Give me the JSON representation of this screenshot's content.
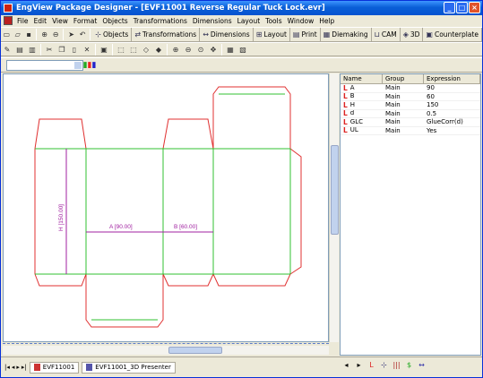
{
  "window": {
    "title": "EngView Package Designer - [EVF11001 Reverse Regular Tuck Lock.evr]"
  },
  "menu": [
    "File",
    "Edit",
    "View",
    "Format",
    "Objects",
    "Transformations",
    "Dimensions",
    "Layout",
    "Tools",
    "Window",
    "Help"
  ],
  "toolbar": {
    "tabs": [
      {
        "name": "objects",
        "label": "Objects",
        "glyph": "⊹"
      },
      {
        "name": "transformations",
        "label": "Transformations",
        "glyph": "⇄"
      },
      {
        "name": "dimensions",
        "label": "Dimensions",
        "glyph": "↔"
      },
      {
        "name": "layout",
        "label": "Layout",
        "glyph": "⊞"
      },
      {
        "name": "print",
        "label": "Print",
        "glyph": "▤"
      },
      {
        "name": "diemaking",
        "label": "Diemaking",
        "glyph": "▦"
      },
      {
        "name": "cam",
        "label": "CAM",
        "glyph": "⊔"
      },
      {
        "name": "3d",
        "label": "3D",
        "glyph": "◈"
      },
      {
        "name": "counterplate",
        "label": "Counterplate",
        "glyph": "▣"
      }
    ]
  },
  "drawing": {
    "dim_a": "A [90.00]",
    "dim_b": "B [60.00]",
    "dim_h": "H [150.00]"
  },
  "params": {
    "headers": {
      "name": "Name",
      "group": "Group",
      "expression": "Expression"
    },
    "rows": [
      {
        "name": "A",
        "group": "Main",
        "expression": "90"
      },
      {
        "name": "B",
        "group": "Main",
        "expression": "60"
      },
      {
        "name": "H",
        "group": "Main",
        "expression": "150"
      },
      {
        "name": "d",
        "group": "Main",
        "expression": "0.5"
      },
      {
        "name": "GLC",
        "group": "Main",
        "expression": "GlueCorr(d)"
      },
      {
        "name": "UL",
        "group": "Main",
        "expression": "Yes"
      }
    ]
  },
  "status": {
    "tabs": [
      {
        "label": "EVF11001"
      },
      {
        "label": "EVF11001_3D Presenter"
      }
    ]
  },
  "colors": {
    "cut": "#e03030",
    "crease": "#30c030",
    "dim": "#a020a0",
    "titlebar": "#0a5fd7"
  }
}
